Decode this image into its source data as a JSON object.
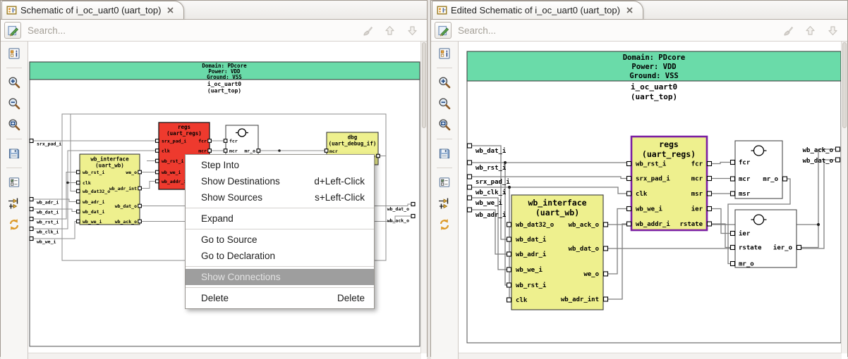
{
  "tabs": {
    "left": "Schematic of i_oc_uart0 (uart_top)",
    "right": "Edited Schematic of i_oc_uart0 (uart_top)"
  },
  "search": {
    "placeholder": "Search..."
  },
  "toolbar": {
    "buttons": [
      "component-info",
      "zoom-in",
      "zoom-out",
      "zoom-fit",
      "save",
      "filter-options",
      "trace-connections",
      "refresh"
    ]
  },
  "colors": {
    "domain_band_green": "#6ADBA9",
    "module_yellow": "#EEF08E",
    "highlight_red": "#EE3A2E",
    "selection_purple": "#7B1FA2",
    "menu_highlight_gray": "#9E9E9E"
  },
  "left_schematic": {
    "header": {
      "domain": "Domain: PDcore",
      "power": "Power: VDD",
      "ground": "Ground: VSS"
    },
    "instance": "i_oc_uart0",
    "module": "(uart_top)",
    "inputs": [
      "srx_pad_i",
      "wb_adr_i",
      "wb_dat_i",
      "wb_rst_i",
      "wb_clk_i",
      "wb_we_i"
    ],
    "outputs": [
      "wb_dat_o",
      "wb_ack_o"
    ],
    "regs": {
      "title": "regs",
      "subtitle": "(uart_regs)",
      "lports": [
        "srx_pad_i",
        "clk",
        "wb_rst_i",
        "wb_we_i",
        "wb_addr_i"
      ],
      "rports": [
        "fcr",
        "mcr"
      ]
    },
    "proc": {
      "lports": [
        "fcr",
        "mcr"
      ],
      "rports": [
        "mr_o"
      ]
    },
    "dbg": {
      "title": "dbg",
      "subtitle": "(uart_debug_if)",
      "lports": [
        "mcr"
      ],
      "rports": [
        "_o"
      ]
    },
    "wbif": {
      "title": "wb_interface",
      "subtitle": "(uart_wb)",
      "lports": [
        "wb_rst_i",
        "clk",
        "wb_dat32_o",
        "wb_adr_i",
        "wb_dat_i",
        "wb_we_i"
      ],
      "rports": [
        "we_o",
        "wb_adr_int",
        "wb_dat_o",
        "wb_ack_o"
      ]
    }
  },
  "right_schematic": {
    "header": {
      "domain": "Domain: PDcore",
      "power": "Power: VDD",
      "ground": "Ground: VSS"
    },
    "instance": "i_oc_uart0",
    "module": "(uart_top)",
    "inputs": [
      "wb_dat_i",
      "wb_rst_i",
      "srx_pad_i",
      "wb_clk_i",
      "wb_we_i",
      "wb_adr_i"
    ],
    "outputs": [
      "wb_ack_o",
      "wb_dat_o"
    ],
    "regs": {
      "title": "regs",
      "subtitle": "(uart_regs)",
      "lports": [
        "wb_rst_i",
        "srx_pad_i",
        "clk",
        "wb_we_i",
        "wb_addr_i"
      ],
      "rports": [
        "fcr",
        "mcr",
        "msr",
        "ier",
        "rstate"
      ]
    },
    "wbif": {
      "title": "wb_interface",
      "subtitle": "(uart_wb)",
      "lports": [
        "wb_dat32_o",
        "wb_dat_i",
        "wb_adr_i",
        "wb_we_i",
        "wb_rst_i",
        "clk"
      ],
      "rports": [
        "wb_ack_o",
        "wb_dat_o",
        "we_o",
        "wb_adr_int"
      ]
    },
    "proc1": {
      "lports": [
        "fcr",
        "mcr",
        "msr"
      ],
      "rports": [
        "mr_o"
      ]
    },
    "proc2": {
      "lports": [
        "ier",
        "rstate",
        "mr_o"
      ],
      "rports": [
        "ier_o"
      ]
    }
  },
  "context_menu": {
    "items": [
      {
        "label": "Step Into",
        "shortcut": ""
      },
      {
        "label": "Show Destinations",
        "shortcut": "d+Left-Click"
      },
      {
        "label": "Show Sources",
        "shortcut": "s+Left-Click"
      },
      {
        "label": "Expand",
        "shortcut": ""
      },
      {
        "label": "Go to Source",
        "shortcut": ""
      },
      {
        "label": "Go to Declaration",
        "shortcut": ""
      },
      {
        "label": "Show Connections",
        "shortcut": ""
      },
      {
        "label": "Delete",
        "shortcut": "Delete"
      }
    ]
  }
}
